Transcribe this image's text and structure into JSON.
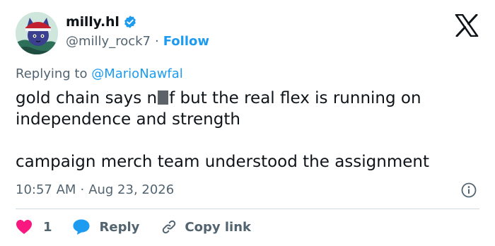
{
  "user": {
    "display_name": "milly.hl",
    "handle": "@milly_rock7",
    "separator": "·",
    "follow_label": "Follow"
  },
  "reply": {
    "prefix": "Replying to",
    "mention": "@MarioNawfal"
  },
  "tweet": {
    "line1_before": "gold chain says n",
    "line1_after": "f but the real flex is running on",
    "line2": "independence and strength",
    "line3": "campaign merch team understood the assignment"
  },
  "meta": {
    "time": "10:57 AM",
    "separator": "·",
    "date": "Aug 23, 2026"
  },
  "actions": {
    "like_count": "1",
    "reply_label": "Reply",
    "copy_label": "Copy link"
  },
  "colors": {
    "accent": "#1d9bf0",
    "like": "#f91880",
    "text": "#0f1419",
    "muted": "#536471"
  }
}
